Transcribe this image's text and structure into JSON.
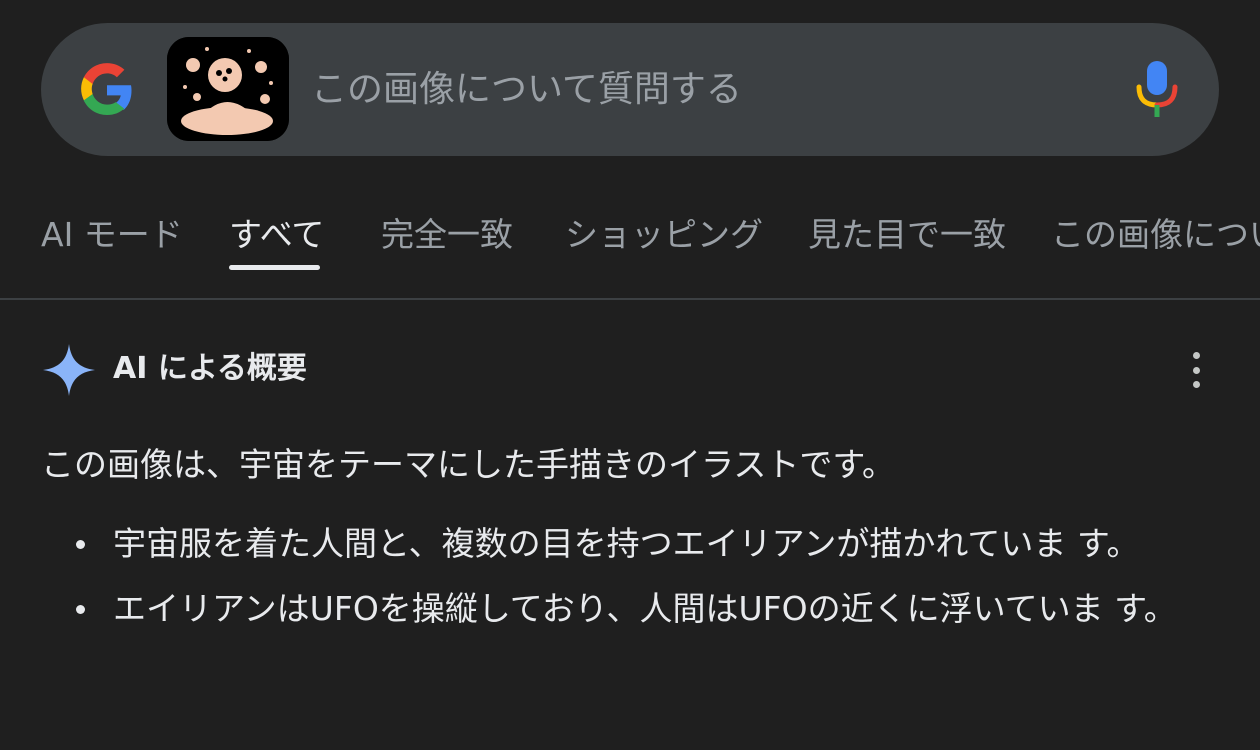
{
  "search": {
    "placeholder": "この画像について質問する",
    "google_logo_icon": "google-g-icon",
    "mic_icon": "microphone-icon",
    "image_thumbnail": "space-illustration-thumbnail"
  },
  "tabs": [
    {
      "label": "AI モード",
      "active": false
    },
    {
      "label": "すべて",
      "active": true
    },
    {
      "label": "完全一致",
      "active": false
    },
    {
      "label": "ショッピング",
      "active": false
    },
    {
      "label": "見た目で一致",
      "active": false
    },
    {
      "label": "この画像につい",
      "active": false
    }
  ],
  "ai_overview": {
    "title": "AI による概要",
    "icon": "sparkle-icon",
    "menu_icon": "more-vert-icon",
    "summary": "この画像は、宇宙をテーマにした手描きのイラストです。",
    "bullets": [
      "宇宙服を着た人間と、複数の目を持つエイリアンが描かれていま す。",
      "エイリアンはUFOを操縦しており、人間はUFOの近くに浮いていま す。"
    ]
  },
  "colors": {
    "background": "#1f1f1f",
    "search_bar": "#3c4043",
    "sparkle": "#8ab4f8",
    "text_primary": "#e8eaed",
    "text_secondary": "#9aa0a6"
  }
}
